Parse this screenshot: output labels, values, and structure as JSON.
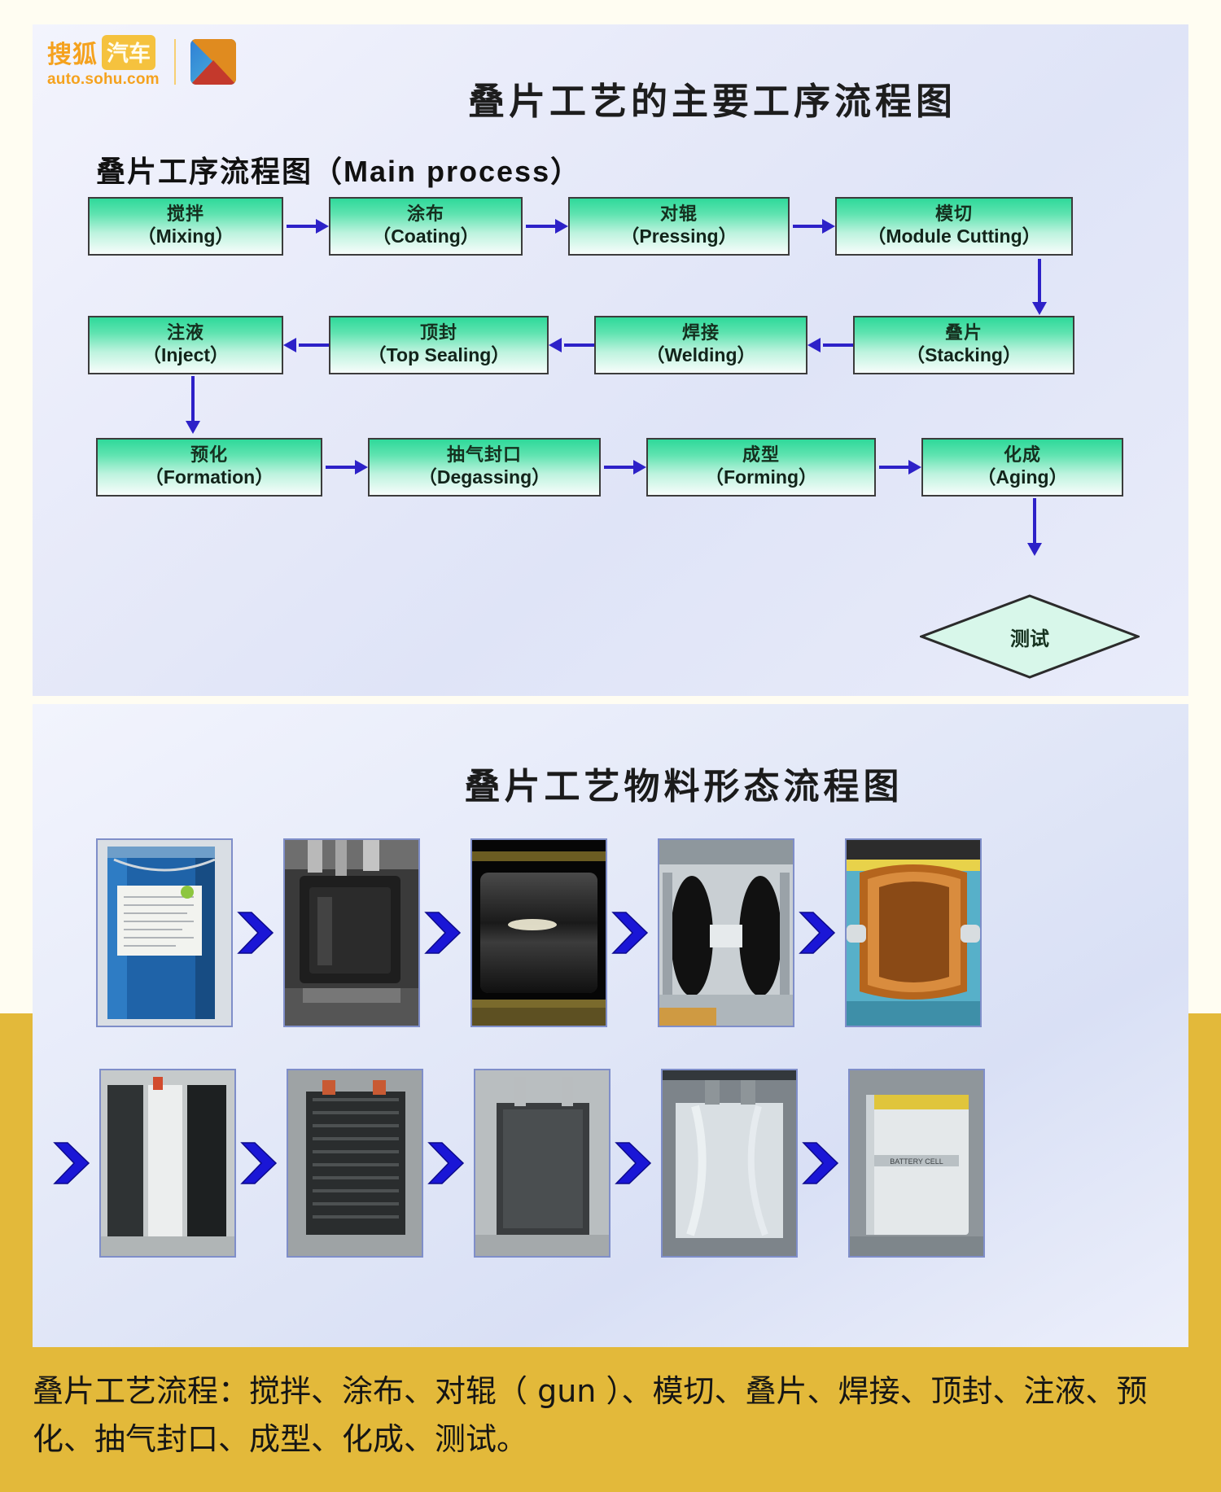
{
  "brand": {
    "name_cn_1": "搜狐",
    "name_cn_2": "汽车",
    "url": "auto.sohu.com",
    "icon": "sohu-auto-logo-icon",
    "accent_orange": "#f5a21e",
    "accent_yellow": "#f5c23e"
  },
  "panel1": {
    "main_title": "叠片工艺的主要工序流程图",
    "sub_title_cn": "叠片工序流程图",
    "sub_title_en": "（Main process）",
    "node_fill_top": "#2fd99a",
    "arrow_color": "#2d21c8",
    "rows": [
      {
        "direction": "right",
        "nodes": [
          {
            "cn": "搅拌",
            "en": "（Mixing）"
          },
          {
            "cn": "涂布",
            "en": "（Coating）"
          },
          {
            "cn": "对辊",
            "en": "（Pressing）"
          },
          {
            "cn": "模切",
            "en": "（Module Cutting）"
          }
        ]
      },
      {
        "direction": "left",
        "nodes": [
          {
            "cn": "注液",
            "en": "（Inject）"
          },
          {
            "cn": "顶封",
            "en": "（Top Sealing）"
          },
          {
            "cn": "焊接",
            "en": "（Welding）"
          },
          {
            "cn": "叠片",
            "en": "（Stacking）"
          }
        ]
      },
      {
        "direction": "right",
        "nodes": [
          {
            "cn": "预化",
            "en": "（Formation）"
          },
          {
            "cn": "抽气封口",
            "en": "（Degassing）"
          },
          {
            "cn": "成型",
            "en": "（Forming）"
          },
          {
            "cn": "化成",
            "en": "（Aging）"
          }
        ]
      }
    ],
    "terminal": {
      "cn": "测试",
      "shape": "diamond"
    }
  },
  "panel2": {
    "title": "叠片工艺物料形态流程图",
    "arrow_color": "#1a16d6",
    "row1": [
      {
        "alt": "blue-chemical-drum-photo"
      },
      {
        "alt": "mixing-machine-photo"
      },
      {
        "alt": "coating-roll-photo"
      },
      {
        "alt": "pressing-rollers-photo"
      },
      {
        "alt": "copper-foil-roll-photo"
      }
    ],
    "row2": [
      {
        "alt": "cut-electrode-sheets-photo"
      },
      {
        "alt": "stacked-cell-photo"
      },
      {
        "alt": "welded-tabs-cell-photo"
      },
      {
        "alt": "pouch-sealed-cell-photo"
      },
      {
        "alt": "finished-battery-photo"
      }
    ]
  },
  "caption": {
    "line1": "叠片工艺流程：搅拌、涂布、对辊（ gun ）、模切、叠片、焊接、顶封、注液、预",
    "line2": "化、抽气封口、成型、化成、测试。",
    "background": "#e3b93a"
  }
}
